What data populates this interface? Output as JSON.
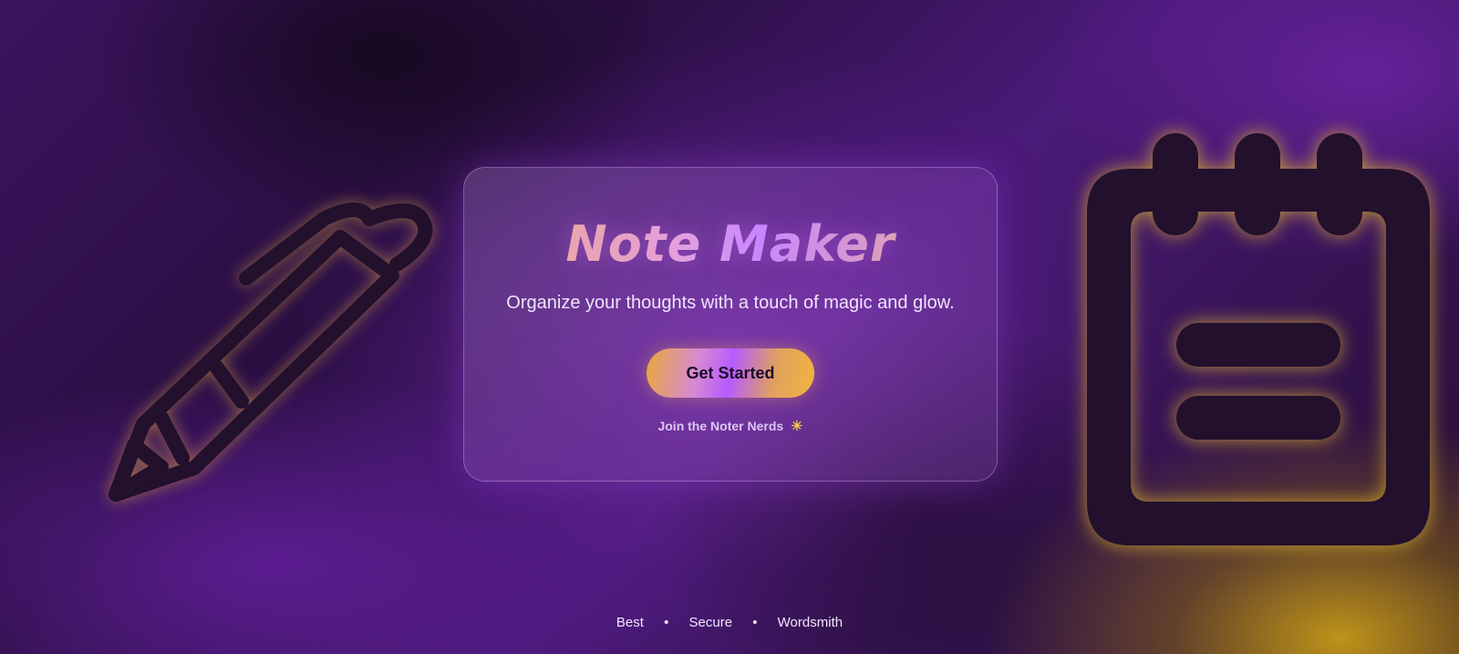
{
  "hero": {
    "title": "Note Maker",
    "subtitle": "Organize your thoughts with a touch of magic and glow.",
    "cta_label": "Get Started",
    "tagline": "Join the Noter Nerds",
    "tagline_icon": "☀"
  },
  "footer": {
    "items": [
      "Best",
      "Secure",
      "Wordsmith"
    ],
    "separator": "•"
  },
  "decorations": {
    "left_icon": "pen-icon",
    "right_icon": "notepad-icon"
  },
  "colors": {
    "background": "#3b145e",
    "accent_gold": "#f2b63c",
    "accent_violet": "#b55cff",
    "icon_fill": "#22102c"
  }
}
